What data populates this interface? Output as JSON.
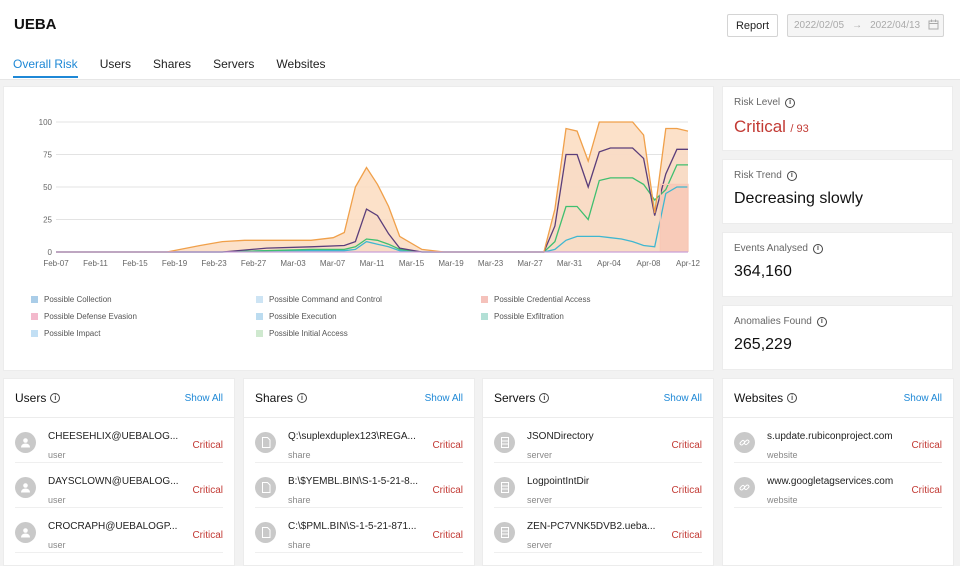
{
  "header": {
    "title": "UEBA",
    "report_label": "Report",
    "date_from": "2022/02/05",
    "date_arrow": "→",
    "date_to": "2022/04/13"
  },
  "tabs": [
    {
      "label": "Overall Risk",
      "active": true
    },
    {
      "label": "Users",
      "active": false
    },
    {
      "label": "Shares",
      "active": false
    },
    {
      "label": "Servers",
      "active": false
    },
    {
      "label": "Websites",
      "active": false
    }
  ],
  "metrics": {
    "risk_level": {
      "label": "Risk Level",
      "value": "Critical",
      "suffix": "/ 93"
    },
    "risk_trend": {
      "label": "Risk Trend",
      "value": "Decreasing slowly"
    },
    "events": {
      "label": "Events Analysed",
      "value": "364,160"
    },
    "anomalies": {
      "label": "Anomalies Found",
      "value": "265,229"
    }
  },
  "lists": {
    "users": {
      "title": "Users",
      "show_all": "Show All",
      "icon": "user-icon",
      "rows": [
        {
          "name": "CHEESEHLIX@UEBALOG...",
          "type": "user",
          "level": "Critical"
        },
        {
          "name": "DAYSCLOWN@UEBALOG...",
          "type": "user",
          "level": "Critical"
        },
        {
          "name": "CROCRAPH@UEBALOGP...",
          "type": "user",
          "level": "Critical"
        }
      ]
    },
    "shares": {
      "title": "Shares",
      "show_all": "Show All",
      "icon": "file-icon",
      "rows": [
        {
          "name": "Q:\\suplexduplex123\\REGA...",
          "type": "share",
          "level": "Critical"
        },
        {
          "name": "B:\\$YEMBL.BIN\\S-1-5-21-8...",
          "type": "share",
          "level": "Critical"
        },
        {
          "name": "C:\\$PML.BIN\\S-1-5-21-871...",
          "type": "share",
          "level": "Critical"
        }
      ]
    },
    "servers": {
      "title": "Servers",
      "show_all": "Show All",
      "icon": "server-icon",
      "rows": [
        {
          "name": "JSONDirectory",
          "type": "server",
          "level": "Critical"
        },
        {
          "name": "LogpointIntDir",
          "type": "server",
          "level": "Critical"
        },
        {
          "name": "ZEN-PC7VNK5DVB2.ueba...",
          "type": "server",
          "level": "Critical"
        }
      ]
    },
    "websites": {
      "title": "Websites",
      "show_all": "Show All",
      "icon": "link-icon",
      "rows": [
        {
          "name": "s.update.rubiconproject.com",
          "type": "website",
          "level": "Critical"
        },
        {
          "name": "www.googletagservices.com",
          "type": "website",
          "level": "Critical"
        }
      ]
    }
  },
  "colors": {
    "accent": "#1e88d6",
    "critical": "#c23a34"
  },
  "chart_data": {
    "type": "area",
    "title": "",
    "xlabel": "",
    "ylabel": "",
    "ylim": [
      0,
      100
    ],
    "yticks": [
      0,
      25,
      50,
      75,
      100
    ],
    "x_tick_labels": [
      "Feb-07",
      "Feb-11",
      "Feb-15",
      "Feb-19",
      "Feb-23",
      "Feb-27",
      "Mar-03",
      "Mar-07",
      "Mar-11",
      "Mar-15",
      "Mar-19",
      "Mar-23",
      "Mar-27",
      "Mar-31",
      "Apr-04",
      "Apr-08",
      "Apr-12"
    ],
    "grid": true,
    "legend_placement": "bottom",
    "series": [
      {
        "name": "Possible Collection",
        "color": "#2e86c1",
        "fill": "#aacde8"
      },
      {
        "name": "Possible Command and Control",
        "color": "#5dade2",
        "fill": "#cde4f4"
      },
      {
        "name": "Possible Credential Access",
        "color": "#e74c3c",
        "fill": "#f5c2bb"
      },
      {
        "name": "Possible Defense Evasion",
        "color": "#e55b8a",
        "fill": "#f3b9cc"
      },
      {
        "name": "Possible Execution",
        "color": "#41a3d8",
        "fill": "#bcdcf0"
      },
      {
        "name": "Possible Exfiltration",
        "color": "#16a085",
        "fill": "#b3e0d6"
      },
      {
        "name": "Possible Impact",
        "color": "#3b9ee0",
        "fill": "#c2dff4"
      },
      {
        "name": "Possible Initial Access",
        "color": "#4caf50",
        "fill": "#cfe9cf"
      }
    ],
    "layers": [
      {
        "name": "Possible Impact / Command and Control",
        "fill": "#c7e4f2",
        "stroke": "#3fb7d0",
        "points": [
          [
            0,
            0
          ],
          [
            15,
            0
          ],
          [
            19,
            1
          ],
          [
            23,
            1
          ],
          [
            26,
            1
          ],
          [
            27,
            2
          ],
          [
            28,
            8
          ],
          [
            29,
            6
          ],
          [
            30,
            4
          ],
          [
            31,
            1
          ],
          [
            33,
            0
          ],
          [
            44,
            0
          ],
          [
            45,
            2
          ],
          [
            46,
            9
          ],
          [
            47,
            12
          ],
          [
            48,
            12
          ],
          [
            49,
            12
          ],
          [
            50,
            11
          ],
          [
            51,
            10
          ],
          [
            52,
            8
          ],
          [
            53,
            5
          ],
          [
            54,
            4
          ],
          [
            55,
            45
          ],
          [
            56,
            50
          ],
          [
            57,
            50
          ]
        ]
      },
      {
        "name": "Possible Initial Access",
        "fill": "#d3edd2",
        "stroke": "#3fbf6f",
        "points": [
          [
            0,
            0
          ],
          [
            15,
            0
          ],
          [
            19,
            1
          ],
          [
            23,
            2
          ],
          [
            26,
            2
          ],
          [
            27,
            4
          ],
          [
            28,
            10
          ],
          [
            29,
            9
          ],
          [
            30,
            6
          ],
          [
            31,
            2
          ],
          [
            33,
            0
          ],
          [
            44,
            0
          ],
          [
            45,
            8
          ],
          [
            46,
            35
          ],
          [
            47,
            35
          ],
          [
            48,
            25
          ],
          [
            49,
            55
          ],
          [
            50,
            57
          ],
          [
            51,
            57
          ],
          [
            52,
            57
          ],
          [
            53,
            52
          ],
          [
            54,
            40
          ],
          [
            55,
            48
          ],
          [
            56,
            67
          ],
          [
            57,
            67
          ]
        ]
      },
      {
        "name": "Possible Defense Evasion",
        "fill": "#e3d6e8",
        "stroke": "#5b3e7a",
        "points": [
          [
            0,
            0
          ],
          [
            15,
            0
          ],
          [
            19,
            3
          ],
          [
            23,
            4
          ],
          [
            26,
            5
          ],
          [
            27,
            8
          ],
          [
            28,
            33
          ],
          [
            29,
            28
          ],
          [
            30,
            14
          ],
          [
            31,
            3
          ],
          [
            33,
            0
          ],
          [
            44,
            0
          ],
          [
            45,
            20
          ],
          [
            46,
            75
          ],
          [
            47,
            75
          ],
          [
            48,
            50
          ],
          [
            49,
            77
          ],
          [
            50,
            80
          ],
          [
            51,
            80
          ],
          [
            52,
            80
          ],
          [
            53,
            72
          ],
          [
            54,
            28
          ],
          [
            55,
            60
          ],
          [
            56,
            79
          ],
          [
            57,
            79
          ]
        ]
      },
      {
        "name": "Possible Collection (total)",
        "fill": "#fbdcc0",
        "stroke": "#f0a04a",
        "points": [
          [
            0,
            0
          ],
          [
            10,
            0
          ],
          [
            13,
            5
          ],
          [
            15,
            8
          ],
          [
            17,
            9
          ],
          [
            19,
            9
          ],
          [
            21,
            9
          ],
          [
            23,
            9
          ],
          [
            25,
            11
          ],
          [
            26,
            15
          ],
          [
            27,
            50
          ],
          [
            28,
            65
          ],
          [
            29,
            52
          ],
          [
            30,
            35
          ],
          [
            31,
            12
          ],
          [
            33,
            2
          ],
          [
            35,
            0
          ],
          [
            44,
            0
          ],
          [
            45,
            33
          ],
          [
            46,
            95
          ],
          [
            47,
            93
          ],
          [
            48,
            70
          ],
          [
            49,
            100
          ],
          [
            50,
            100
          ],
          [
            51,
            100
          ],
          [
            52,
            100
          ],
          [
            53,
            90
          ],
          [
            54,
            30
          ],
          [
            55,
            95
          ],
          [
            56,
            95
          ],
          [
            57,
            93
          ]
        ]
      },
      {
        "name": "Possible Credential Access",
        "fill": "#f8c8b6",
        "stroke": "#f8c8b6",
        "points": [
          [
            54.5,
            0
          ],
          [
            54.5,
            52
          ],
          [
            55,
            52
          ],
          [
            57,
            52
          ],
          [
            57,
            0
          ]
        ]
      }
    ]
  }
}
